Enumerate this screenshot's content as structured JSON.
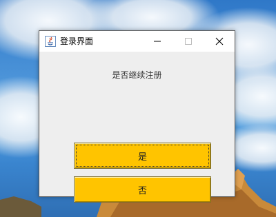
{
  "window": {
    "title": "登录界面",
    "icon": "java-icon"
  },
  "controls": {
    "minimize_icon": "minimize-icon",
    "maximize_icon": "maximize-icon",
    "close_icon": "close-icon"
  },
  "dialog": {
    "prompt": "是否继续注册",
    "yes_label": "是",
    "no_label": "否"
  },
  "colors": {
    "button": "#ffc400",
    "panel": "#eeeeee"
  }
}
